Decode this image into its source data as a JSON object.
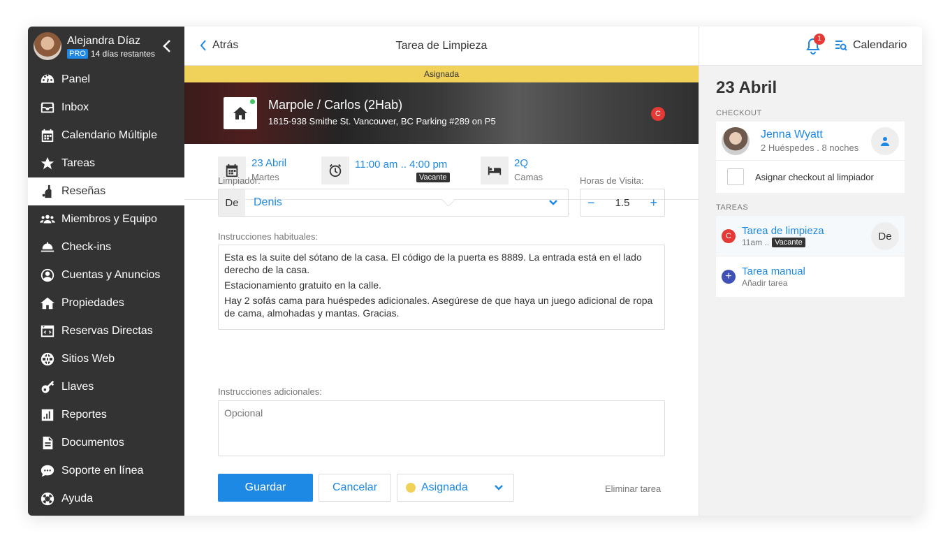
{
  "profile": {
    "name": "Alejandra Díaz",
    "plan": "PRO",
    "trial": "14 días restantes"
  },
  "nav": [
    {
      "label": "Panel",
      "icon": "dashboard-icon"
    },
    {
      "label": "Inbox",
      "icon": "inbox-icon"
    },
    {
      "label": "Calendario Múltiple",
      "icon": "calendar-icon"
    },
    {
      "label": "Tareas",
      "icon": "star-icon"
    },
    {
      "label": "Reseñas",
      "icon": "cleaning-icon"
    },
    {
      "label": "Miembros y Equipo",
      "icon": "team-icon"
    },
    {
      "label": "Check-ins",
      "icon": "bell-service-icon"
    },
    {
      "label": "Cuentas y Anuncios",
      "icon": "account-icon"
    },
    {
      "label": "Propiedades",
      "icon": "home-icon"
    },
    {
      "label": "Reservas Directas",
      "icon": "code-window-icon"
    },
    {
      "label": "Sitios Web",
      "icon": "globe-icon"
    },
    {
      "label": "Llaves",
      "icon": "key-icon"
    },
    {
      "label": "Reportes",
      "icon": "chart-icon"
    },
    {
      "label": "Documentos",
      "icon": "document-icon"
    },
    {
      "label": "Soporte en línea",
      "icon": "chat-icon"
    },
    {
      "label": "Ayuda",
      "icon": "lifebuoy-icon"
    }
  ],
  "header": {
    "back": "Atrás",
    "title": "Tarea de Limpieza",
    "notifications": "1",
    "calendar": "Calendario"
  },
  "task": {
    "status": "Asignada",
    "property": "Marpole / Carlos (2Hab)",
    "address": "1815-938 Smithe St. Vancouver, BC Parking #289 on P5",
    "badge": "C",
    "date": "23 Abril",
    "weekday": "Martes",
    "time": "11:00 am .. 4:00 pm",
    "time_tag": "Vacante",
    "beds": "2Q",
    "beds_label": "Camas"
  },
  "form": {
    "cleaner_label": "Limpiador:",
    "cleaner_prefix": "De",
    "cleaner_value": "Denis",
    "hours_label": "Horas de Visita:",
    "hours_minus": "−",
    "hours_value": "1.5",
    "hours_plus": "+",
    "usual_label": "Instrucciones habituales:",
    "usual_lines": [
      "Esta es la suite del sótano de la casa. El código de la puerta es 8889. La entrada está en el lado derecho de la casa.",
      "Estacionamiento gratuito en la calle.",
      "Hay 2 sofás cama para huéspedes adicionales. Asegúrese de que haya un juego adicional de ropa de cama, almohadas y mantas. Gracias."
    ],
    "extra_label": "Instrucciones adicionales:",
    "extra_placeholder": "Opcional",
    "save": "Guardar",
    "cancel": "Cancelar",
    "status_value": "Asignada",
    "delete": "Eliminar tarea"
  },
  "panel": {
    "date": "23 Abril",
    "checkout_label": "CHECKOUT",
    "guest_name": "Jenna Wyatt",
    "guest_sub": "2 Huéspedes . 8 noches",
    "assign_checkout": "Asignar checkout al limpiador",
    "tasks_label": "TAREAS",
    "task1_badge": "C",
    "task1_name": "Tarea de limpieza",
    "task1_time": "11am ..",
    "task1_tag": "Vacante",
    "task1_assignee": "De",
    "task2_name": "Tarea manual",
    "task2_sub": "Añadir tarea"
  },
  "colors": {
    "accent": "#1e88e5",
    "status": "#f0d15a",
    "sidebar": "#333333",
    "alert": "#e53935"
  }
}
